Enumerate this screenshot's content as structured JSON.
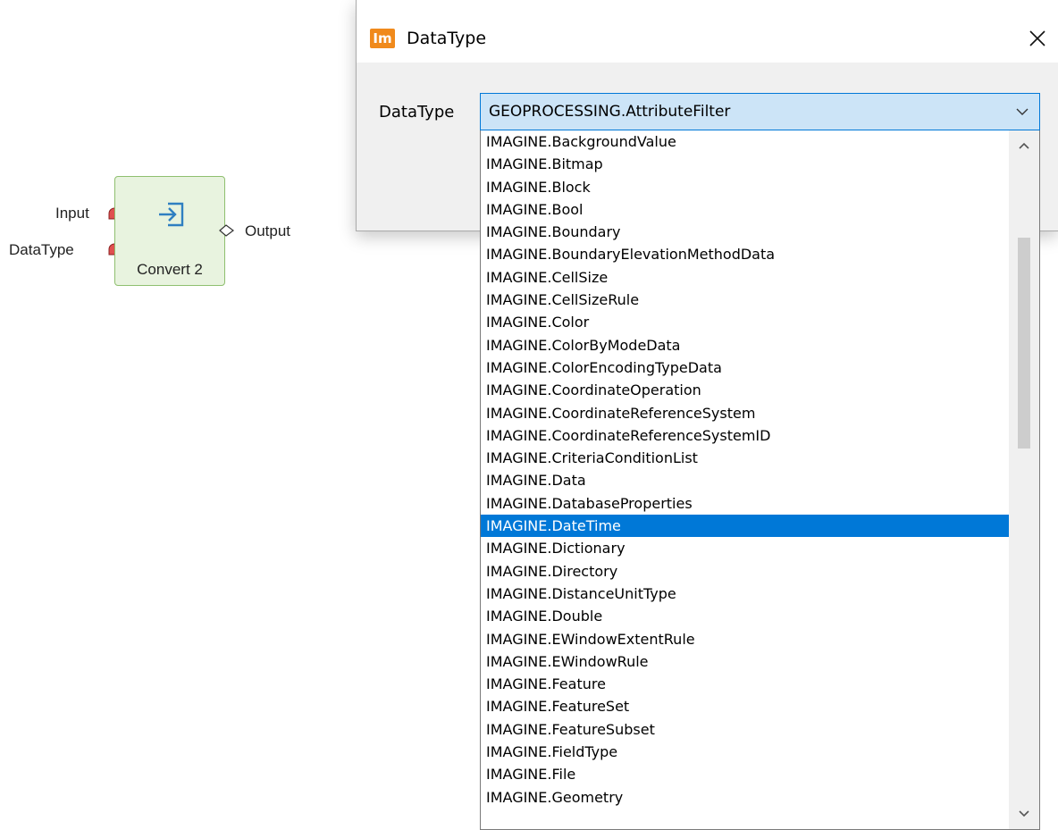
{
  "canvas": {
    "operator": {
      "label": "Convert 2",
      "icon": "convert-arrow-icon",
      "inputs": [
        {
          "label": "Input",
          "color": "#e05050"
        },
        {
          "label": "DataType",
          "color": "#e05050"
        }
      ],
      "output": {
        "label": "Output"
      }
    }
  },
  "dialog": {
    "title": "DataType",
    "app_icon_text": "Im",
    "app_icon_color": "#f08a1c",
    "field_label": "DataType",
    "combo": {
      "value": "GEOPROCESSING.AttributeFilter"
    },
    "dropdown": {
      "items": [
        "IMAGINE.BackgroundValue",
        "IMAGINE.Bitmap",
        "IMAGINE.Block",
        "IMAGINE.Bool",
        "IMAGINE.Boundary",
        "IMAGINE.BoundaryElevationMethodData",
        "IMAGINE.CellSize",
        "IMAGINE.CellSizeRule",
        "IMAGINE.Color",
        "IMAGINE.ColorByModeData",
        "IMAGINE.ColorEncodingTypeData",
        "IMAGINE.CoordinateOperation",
        "IMAGINE.CoordinateReferenceSystem",
        "IMAGINE.CoordinateReferenceSystemID",
        "IMAGINE.CriteriaConditionList",
        "IMAGINE.Data",
        "IMAGINE.DatabaseProperties",
        "IMAGINE.DateTime",
        "IMAGINE.Dictionary",
        "IMAGINE.Directory",
        "IMAGINE.DistanceUnitType",
        "IMAGINE.Double",
        "IMAGINE.EWindowExtentRule",
        "IMAGINE.EWindowRule",
        "IMAGINE.Feature",
        "IMAGINE.FeatureSet",
        "IMAGINE.FeatureSubset",
        "IMAGINE.FieldType",
        "IMAGINE.File",
        "IMAGINE.Geometry"
      ],
      "selected_item": "IMAGINE.DateTime",
      "selection_color": "#0078d7",
      "scroll_position": 0.12,
      "visible_fraction": 0.33
    }
  }
}
